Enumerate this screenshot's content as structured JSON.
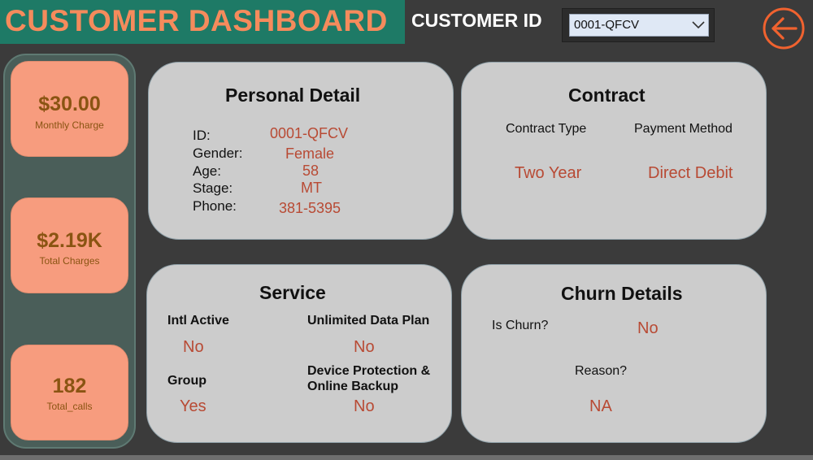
{
  "header": {
    "title": "CUSTOMER DASHBOARD",
    "customer_id_label": "CUSTOMER ID",
    "customer_id_value": "0001-QFCV",
    "back_icon": "arrow-left-circle-icon"
  },
  "kpis": [
    {
      "value": "$30.00",
      "label": "Monthly Charge"
    },
    {
      "value": "$2.19K",
      "label": "Total Charges"
    },
    {
      "value": "182",
      "label": "Total_calls"
    }
  ],
  "personal": {
    "title": "Personal Detail",
    "labels": [
      "ID:",
      "Gender:",
      "Age:",
      "Stage:",
      "Phone:"
    ],
    "values": [
      "0001-QFCV",
      "Female",
      "58",
      "MT",
      "381-5395"
    ]
  },
  "contract": {
    "title": "Contract",
    "type_label": "Contract Type",
    "type_value": "Two Year",
    "payment_label": "Payment Method",
    "payment_value": "Direct Debit"
  },
  "service": {
    "title": "Service",
    "intl_label": "Intl Active",
    "intl_value": "No",
    "unlimited_label": "Unlimited Data Plan",
    "unlimited_value": "No",
    "group_label": "Group",
    "group_value": "Yes",
    "device_label_1": "Device Protection &",
    "device_label_2": "Online Backup",
    "device_value": "No"
  },
  "churn": {
    "title": "Churn Details",
    "is_churn_label": "Is Churn?",
    "is_churn_value": "No",
    "reason_label": "Reason?",
    "reason_value": "NA"
  },
  "colors": {
    "title_bar": "#1e7a66",
    "title_text": "#f58b5c",
    "kpi_bg": "#f79c7e",
    "value_text": "#b84a34",
    "card_bg": "#cccccc"
  }
}
